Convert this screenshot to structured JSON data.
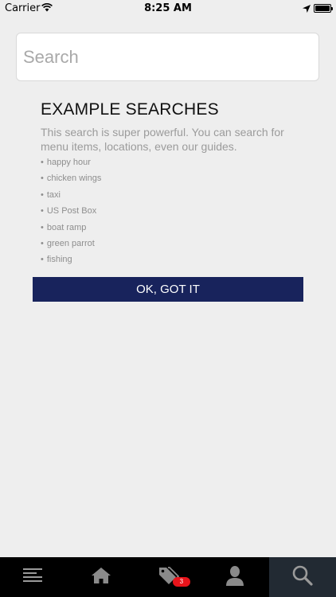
{
  "status_bar": {
    "carrier": "Carrier",
    "time": "8:25 AM"
  },
  "search": {
    "placeholder": "Search",
    "value": ""
  },
  "content": {
    "heading": "EXAMPLE SEARCHES",
    "description": "This search is super powerful. You can search for menu items, locations, even our guides.",
    "examples": [
      "happy hour",
      "chicken wings",
      "taxi",
      "US Post Box",
      "boat ramp",
      "green parrot",
      "fishing"
    ],
    "ok_button_label": "OK, GOT IT"
  },
  "tab_bar": {
    "tabs": [
      {
        "icon": "menu-icon",
        "active": false
      },
      {
        "icon": "home-icon",
        "active": false
      },
      {
        "icon": "tags-icon",
        "active": false,
        "badge": "3"
      },
      {
        "icon": "profile-icon",
        "active": false
      },
      {
        "icon": "search-icon",
        "active": true
      }
    ]
  },
  "colors": {
    "background": "#eeeeee",
    "button": "#18235c",
    "tab_bar": "#000000",
    "tab_active": "#222a33",
    "badge": "#e8141b"
  }
}
